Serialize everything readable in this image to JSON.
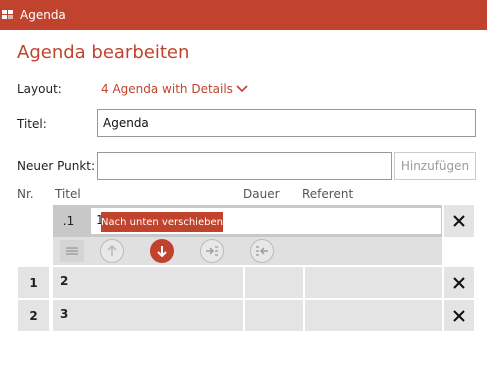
{
  "window": {
    "title": "Agenda",
    "accent": "#c1432d",
    "icon": "app-icon"
  },
  "page": {
    "heading": "Agenda bearbeiten"
  },
  "form": {
    "layout_label": "Layout:",
    "layout_value": "4 Agenda with Details",
    "title_label": "Titel:",
    "title_value": "Agenda",
    "new_item_label": "Neuer Punkt:",
    "new_item_value": "",
    "add_button": "Hinzufügen"
  },
  "table": {
    "headers": {
      "nr": "Nr.",
      "title": "Titel",
      "duration": "Dauer",
      "speaker": "Referent"
    },
    "selected": {
      "number": ".1",
      "title": "1"
    },
    "rows": [
      {
        "number": "1",
        "title": "2"
      },
      {
        "number": "2",
        "title": "3"
      }
    ]
  },
  "toolbar": {
    "tooltip": "Nach unten verschieben",
    "icons": [
      "drag-handle-icon",
      "move-up-icon",
      "move-down-icon",
      "indent-icon",
      "outdent-icon"
    ]
  },
  "delete_icon": "delete-x-icon"
}
